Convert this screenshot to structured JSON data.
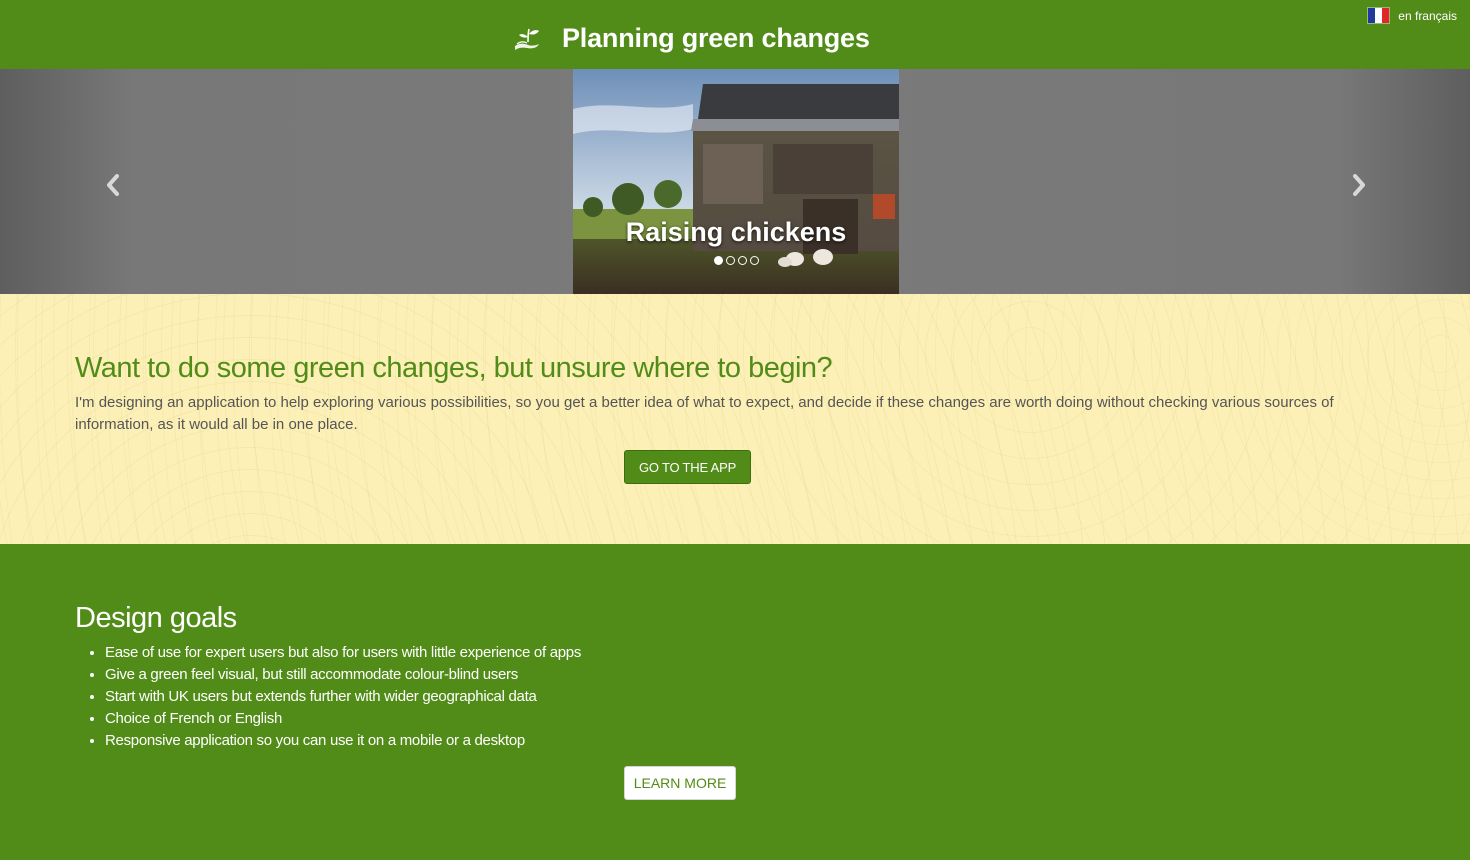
{
  "header": {
    "title": "Planning green changes",
    "logo_icon": "sprout-in-hand-icon",
    "language_link": "en français",
    "language_flag": "france-flag-icon"
  },
  "carousel": {
    "caption": "Raising chickens",
    "slide_count": 4,
    "active_index": 0,
    "prev_icon": "chevron-left-icon",
    "next_icon": "chevron-right-icon"
  },
  "intro": {
    "heading": "Want to do some green changes, but unsure where to begin?",
    "paragraph": "I'm designing an application to help exploring various possibilities, so you get a better idea of what to expect, and decide if these changes are worth doing without checking various sources of information, as it would all be in one place.",
    "button": "GO TO THE APP"
  },
  "goals": {
    "heading": "Design goals",
    "items": [
      "Ease of use for expert users but also for users with little experience of apps",
      "Give a green feel visual, but still accommodate colour-blind users",
      "Start with UK users but extends further with wider geographical data",
      "Choice of French or English",
      "Responsive application so you can use it on a mobile or a desktop"
    ],
    "button": "LEARN MORE"
  },
  "colors": {
    "brand_green": "#528c18",
    "intro_background": "#fcf0b7",
    "carousel_grey": "#787878"
  }
}
